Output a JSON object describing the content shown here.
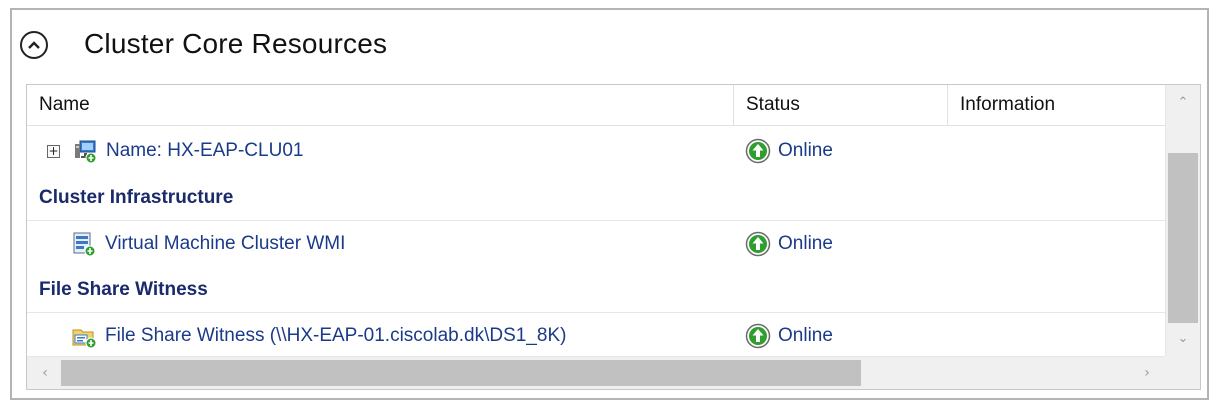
{
  "title": "Cluster Core Resources",
  "columns": [
    "Name",
    "Status",
    "Information"
  ],
  "core_resource": {
    "label": "Name: HX-EAP-CLU01",
    "status": "Online"
  },
  "groups": [
    {
      "label": "Cluster Infrastructure",
      "resource": {
        "label": "Virtual Machine Cluster WMI",
        "status": "Online"
      }
    },
    {
      "label": "File Share Witness",
      "resource": {
        "label": "File Share Witness (\\\\HX-EAP-01.ciscolab.dk\\DS1_8K)",
        "status": "Online"
      }
    }
  ],
  "colors": {
    "link_text": "#1a3a8a",
    "group_text": "#1a2a6a",
    "online_green": "#2e9e2e"
  },
  "icons": {
    "collapse": "chevron-up-circle-icon",
    "expand": "plus-box-icon",
    "cluster_name": "network-name-icon",
    "wmi": "cluster-wmi-icon",
    "witness": "file-share-witness-icon",
    "online": "online-arrow-icon"
  }
}
